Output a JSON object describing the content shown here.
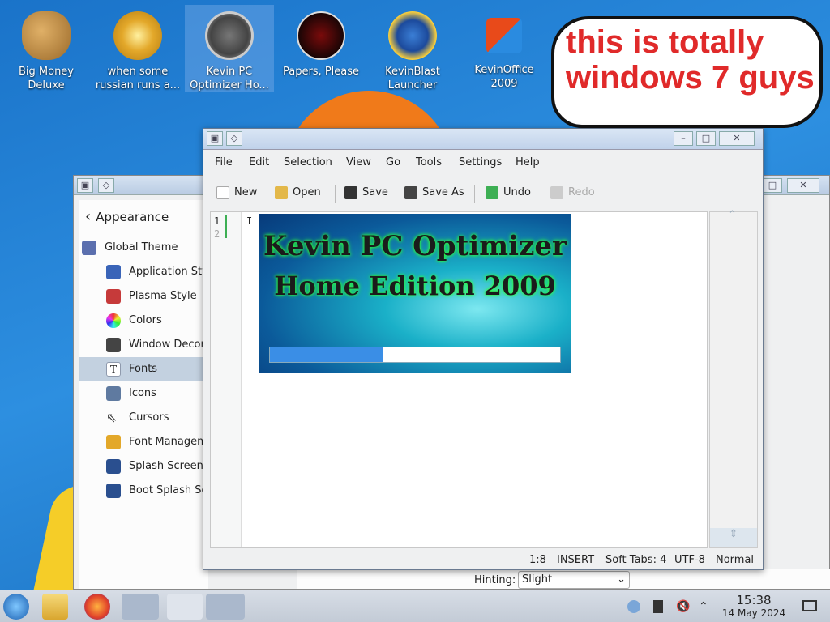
{
  "desktop": {
    "icons": [
      {
        "label": "Big Money Deluxe",
        "icon": "money-bag-icon"
      },
      {
        "label": "when some russian runs a...",
        "icon": "gear-icon"
      },
      {
        "label": "Kevin PC Optimizer Ho...",
        "icon": "gauge-icon"
      },
      {
        "label": "Papers, Please",
        "icon": "emblem-icon"
      },
      {
        "label": "KevinBlast Launcher",
        "icon": "globe-burst-icon"
      },
      {
        "label": "KevinOffice 2009",
        "icon": "office-icon"
      }
    ],
    "bubble_text": "this is totally windows 7 guys"
  },
  "settings_window": {
    "back_label": "Appearance",
    "items": [
      {
        "label": "Global Theme",
        "icon": "globe-theme-icon",
        "color": "#5b6fae"
      },
      {
        "label": "Application Style",
        "icon": "brush-icon",
        "color": "#3a64b8"
      },
      {
        "label": "Plasma Style",
        "icon": "plasma-icon",
        "color": "#c63a3a"
      },
      {
        "label": "Colors",
        "icon": "color-wheel-icon",
        "color": "#e3a82a"
      },
      {
        "label": "Window Decorations",
        "icon": "window-icon",
        "color": "#444444"
      },
      {
        "label": "Fonts",
        "icon": "font-icon",
        "color": "#8f9aad"
      },
      {
        "label": "Icons",
        "icon": "icons-icon",
        "color": "#5f7aa0"
      },
      {
        "label": "Cursors",
        "icon": "cursor-icon",
        "color": "#ffffff"
      },
      {
        "label": "Font Management",
        "icon": "font-manage-icon",
        "color": "#e3a82a"
      },
      {
        "label": "Splash Screen",
        "icon": "monitor-icon",
        "color": "#2a4f8f"
      },
      {
        "label": "Boot Splash Screen",
        "icon": "monitor-icon",
        "color": "#2a4f8f"
      }
    ],
    "selected": "Fonts",
    "hinting_label": "Hinting:",
    "hinting_value": "Slight"
  },
  "editor": {
    "menu": [
      "File",
      "Edit",
      "Selection",
      "View",
      "Go",
      "Tools",
      "Settings",
      "Help"
    ],
    "toolbar": {
      "new": "New",
      "open": "Open",
      "save": "Save",
      "save_as": "Save As",
      "undo": "Undo",
      "redo": "Redo"
    },
    "line_numbers": [
      "1",
      "2"
    ],
    "code_line": "I h",
    "status": {
      "position": "1:8",
      "mode": "INSERT",
      "tabs": "Soft Tabs: 4",
      "encoding": "UTF-8",
      "highlight": "Normal"
    }
  },
  "splash": {
    "title_line1": "Kevin PC Optimizer",
    "title_line2": "Home Edition 2009",
    "progress_fraction": 0.39,
    "colors": {
      "glow": "#2cff3a",
      "bar": "#3a8ee6"
    }
  },
  "taskbar": {
    "apps": [
      "start-icon",
      "files-icon",
      "firefox-icon",
      "settings-app-icon",
      "editor-app-icon",
      "optimizer-app-icon"
    ],
    "time": "15:38",
    "date": "14 May 2024"
  }
}
